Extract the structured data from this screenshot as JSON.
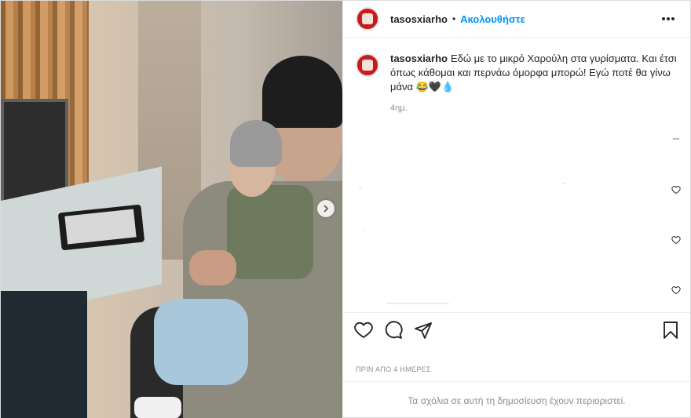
{
  "post": {
    "username": "tasosxiarho",
    "follow_label": "Ακολουθήστε",
    "dot": "•",
    "caption_username": "tasosxiarho",
    "caption_text": "Εδώ με το μικρό Χαρούλη στα γυρίσματα. Και έτσι όπως κάθομαι και περνάω όμορφα μπορώ! Εγώ ποτέ θα γίνω μάνα 😂🖤💧",
    "caption_time": "4ημ.",
    "date": "ΠΡΙΝ ΑΠΟ 4 ΗΜΕΡΕΣ",
    "restricted_notice": "Τα σχόλια σε αυτή τη δημοσίευση έχουν περιοριστεί."
  },
  "icons": {
    "more": "more-options-icon",
    "like": "heart-icon",
    "comment": "comment-icon",
    "share": "share-icon",
    "save": "bookmark-icon",
    "next": "chevron-right-icon"
  },
  "colors": {
    "link": "#0095f6",
    "text": "#262626",
    "muted": "#8e8e8e",
    "avatar": "#c91b1b"
  }
}
